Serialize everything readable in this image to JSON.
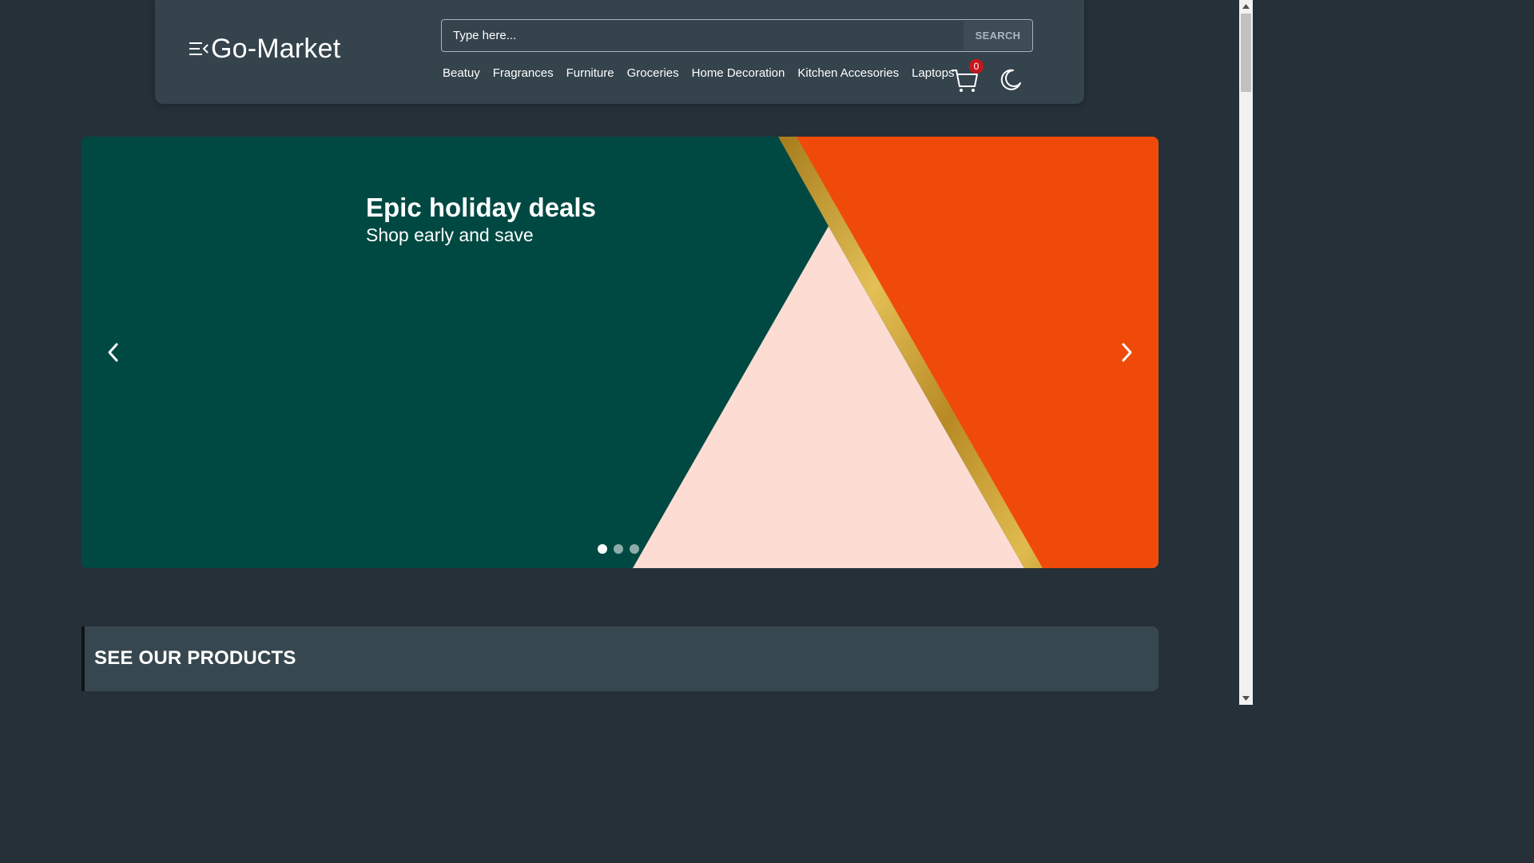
{
  "header": {
    "brand": "Go-Market",
    "search": {
      "placeholder": "Type here...",
      "button_label": "SEARCH"
    },
    "nav": [
      "Beatuy",
      "Fragrances",
      "Furniture",
      "Groceries",
      "Home Decoration",
      "Kitchen Accesories",
      "Laptops"
    ],
    "cart_count": "0",
    "icons": {
      "menu": "menu-collapse-icon",
      "cart": "cart-icon",
      "theme": "moon-icon"
    }
  },
  "carousel": {
    "title": "Epic holiday deals",
    "subtitle": "Shop early and save",
    "slide_count": 3,
    "active_slide": 1,
    "colors": {
      "green": "#004942",
      "orange": "#f04a0a",
      "pink": "#fddcd4",
      "gold": "#c8a02a"
    }
  },
  "section": {
    "title": "SEE OUR PRODUCTS"
  },
  "theme": {
    "background": "#263038",
    "header_bg": "#34434c",
    "badge": "#c5161d"
  }
}
